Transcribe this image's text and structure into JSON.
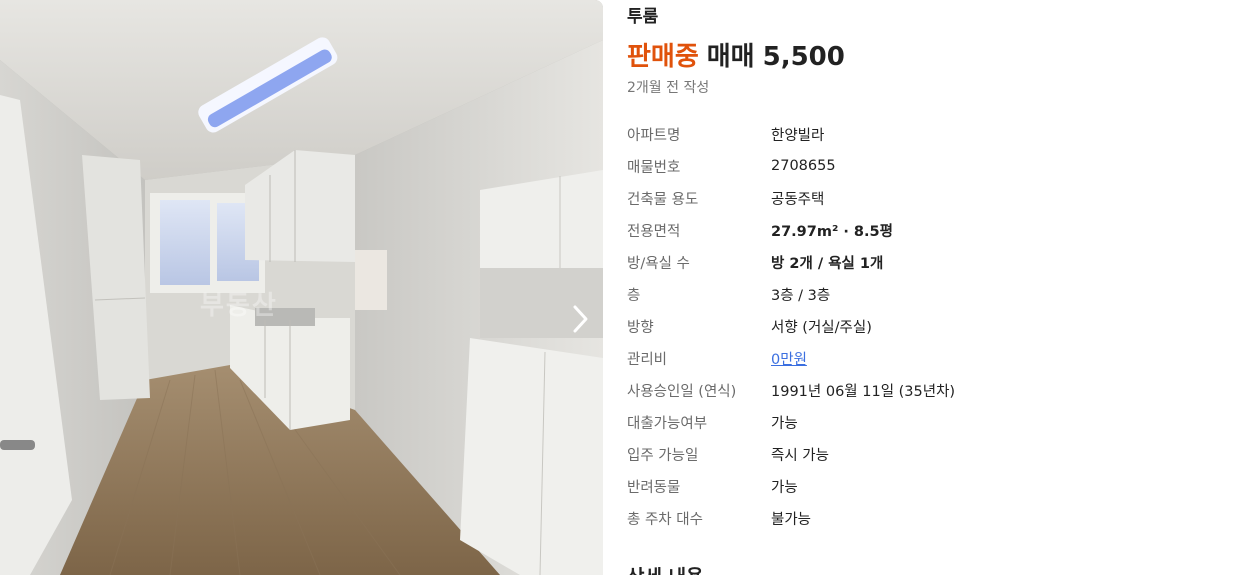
{
  "listing": {
    "type": "투룸",
    "status": "판매중",
    "deal_type": "매매",
    "price": "5,500",
    "posted": "2개월 전 작성"
  },
  "photo": {
    "watermark": "부동산",
    "next_icon": "chevron-right-icon"
  },
  "specs": [
    {
      "label": "아파트명",
      "value": "한양빌라"
    },
    {
      "label": "매물번호",
      "value": "2708655"
    },
    {
      "label": "건축물 용도",
      "value": "공동주택"
    },
    {
      "label": "전용면적",
      "value": "27.97m² · 8.5평"
    },
    {
      "label": "방/욕실 수",
      "value": "방 2개 / 욕실 1개"
    },
    {
      "label": "층",
      "value": "3층 / 3층"
    },
    {
      "label": "방향",
      "value": "서향 (거실/주실)"
    },
    {
      "label": "관리비",
      "value": "0만원"
    },
    {
      "label": "사용승인일 (연식)",
      "value": "1991년 06월 11일 (35년차)"
    },
    {
      "label": "대출가능여부",
      "value": "가능"
    },
    {
      "label": "입주 가능일",
      "value": "즉시 가능"
    },
    {
      "label": "반려동물",
      "value": "가능"
    },
    {
      "label": "총 주차 대수",
      "value": "불가능"
    }
  ],
  "section": {
    "detail_title": "상세 내용"
  },
  "colors": {
    "status": "#e0520b",
    "link": "#3b6fe0",
    "muted": "#777777"
  }
}
